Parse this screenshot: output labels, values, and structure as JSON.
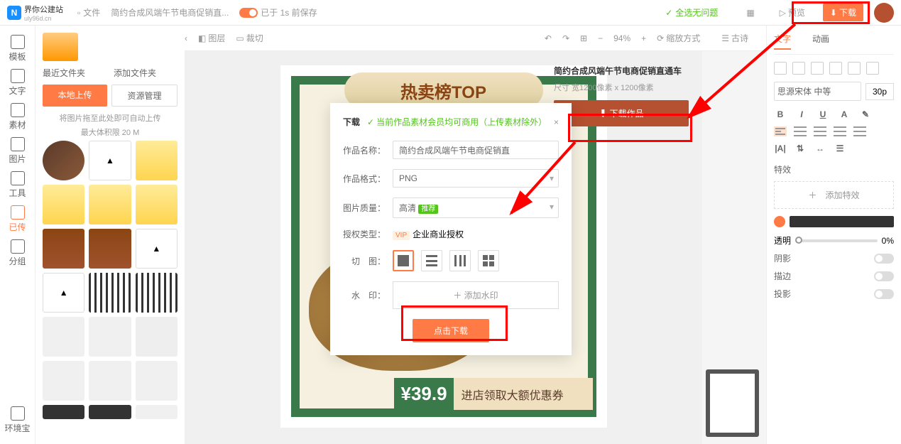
{
  "logo": {
    "letter": "N",
    "name": "界你公建站",
    "sub": "uly96d.cn"
  },
  "topbar": {
    "file": "文件",
    "doc_title": "简约合成风端午节电商促销直...",
    "autosave": "已于 1s 前保存",
    "status": "全选无问题",
    "preview": "预览",
    "download": "下载"
  },
  "secbar": {
    "back": "‹",
    "layer": "图层",
    "crop": "裁切",
    "zoom": "94%",
    "adapt": "缩放方式",
    "grid": "古诗"
  },
  "leftnav": [
    {
      "label": "模板"
    },
    {
      "label": "文字"
    },
    {
      "label": "素材"
    },
    {
      "label": "图片"
    },
    {
      "label": "工具"
    },
    {
      "label": "已传",
      "active": true
    },
    {
      "label": "分组"
    }
  ],
  "leftnav_bottom": "环境宝",
  "assets": {
    "tab1": "最近文件夹",
    "tab2": "添加文件夹",
    "upload": "本地上传",
    "manage": "资源管理",
    "tip1": "将图片拖至此处即可自动上传",
    "tip2": "最大体积限 20 M"
  },
  "design": {
    "banner": "热卖榜TOP",
    "price": "¥39.9",
    "coupon": "进店领取大额优惠券"
  },
  "sidepanel": {
    "title": "简约合成风端午节电商促销直通车",
    "size": "尺寸 宽1200像素 x 1200像素",
    "download": "下载作品"
  },
  "modal": {
    "title": "下载",
    "hint": "当前作品素材会员均可商用（上传素材除外）",
    "name_lbl": "作品名称：",
    "name_val": "简约合成风端午节电商促销直",
    "fmt_lbl": "作品格式：",
    "fmt_val": "PNG",
    "qual_lbl": "图片质量：",
    "qual_val": "高清",
    "qual_badge": "推荐",
    "lic_lbl": "授权类型：",
    "lic_badge": "VIP",
    "lic_val": "企业商业授权",
    "slice_lbl": "切　图：",
    "wm_lbl": "水　印：",
    "wm_val": "＋ 添加水印",
    "submit": "点击下载"
  },
  "props": {
    "tabs": [
      "文字",
      "动画"
    ],
    "font": "思源宋体 中等",
    "size": "30p",
    "bold": "B",
    "italic": "I",
    "underline": "U",
    "A": "A",
    "section_fx": "特效",
    "add_fx": "＋　添加特效",
    "opacity_lbl": "透明",
    "opacity_val": "0%",
    "toggles": [
      "阴影",
      "描边",
      "投影"
    ]
  }
}
